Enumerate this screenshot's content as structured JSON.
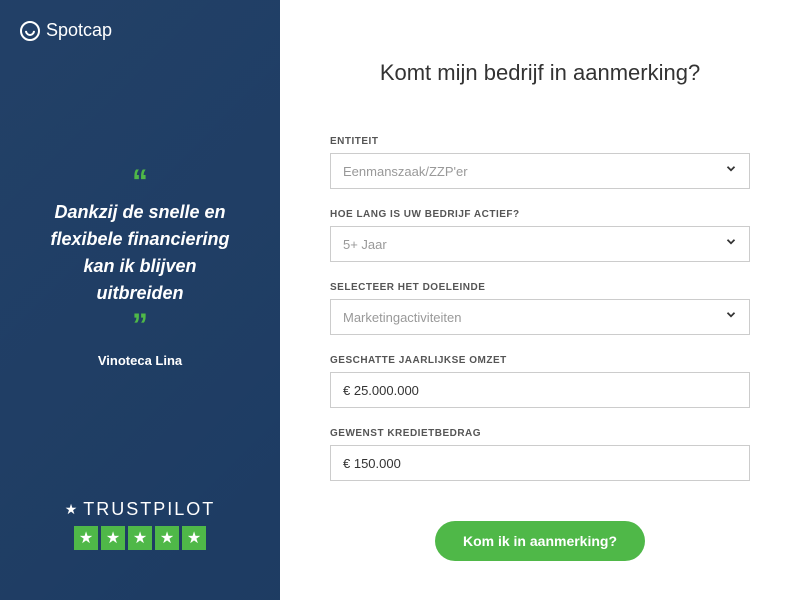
{
  "brand": {
    "name": "Spotcap"
  },
  "testimonial": {
    "quote": "Dankzij de snelle en flexibele financiering kan ik blijven uitbreiden",
    "attribution": "Vinoteca Lina"
  },
  "trustpilot": {
    "label": "TRUSTPILOT"
  },
  "form": {
    "title": "Komt mijn bedrijf in aanmerking?",
    "fields": {
      "entity": {
        "label": "ENTITEIT",
        "placeholder": "Eenmanszaak/ZZP'er"
      },
      "duration": {
        "label": "HOE LANG IS UW BEDRIJF ACTIEF?",
        "placeholder": "5+ Jaar"
      },
      "purpose": {
        "label": "SELECTEER HET DOELEINDE",
        "placeholder": "Marketingactiviteiten"
      },
      "revenue": {
        "label": "GESCHATTE JAARLIJKSE OMZET",
        "value": "€ 25.000.000"
      },
      "amount": {
        "label": "GEWENST KREDIETBEDRAG",
        "value": "€ 150.000"
      }
    },
    "submit": "Kom ik in aanmerking?"
  }
}
